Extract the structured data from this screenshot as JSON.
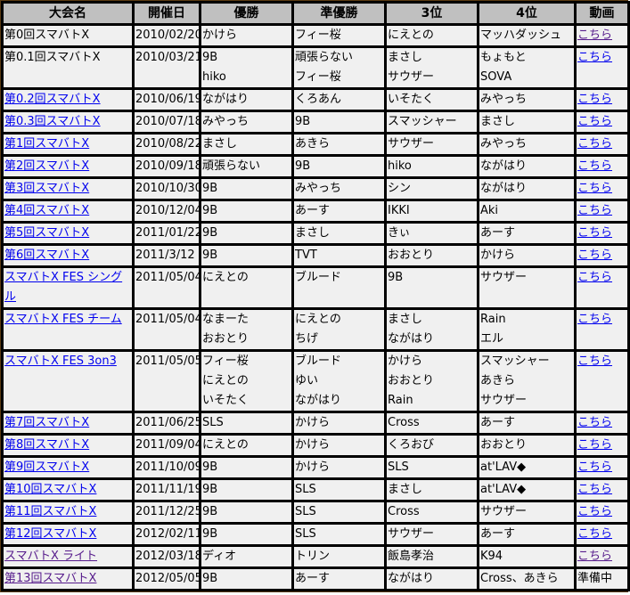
{
  "table": {
    "headers": [
      "大会名",
      "開催日",
      "優勝",
      "準優勝",
      "3位",
      "4位",
      "動画"
    ],
    "rows": [
      {
        "name": "第0回スマバトX",
        "name_link": false,
        "date": "2010/02/20",
        "winner": [
          "かけら"
        ],
        "runner_up": [
          "フィー桜"
        ],
        "third": [
          "にえとの"
        ],
        "fourth": [
          "マッハダッシュ"
        ],
        "video": "こちら",
        "video_visited": true
      },
      {
        "name": "第0.1回スマバトX",
        "name_link": false,
        "date": "2010/03/21",
        "winner": [
          "9B",
          "hiko"
        ],
        "runner_up": [
          "頑張らない",
          "フィー桜"
        ],
        "third": [
          "まさし",
          "サウザー"
        ],
        "fourth": [
          "もょもと",
          "SOVA"
        ],
        "video": "こちら",
        "video_visited": false
      },
      {
        "name": "第0.2回スマバトX",
        "name_link": true,
        "date": "2010/06/19",
        "winner": [
          "ながはり"
        ],
        "runner_up": [
          "くろあん"
        ],
        "third": [
          "いそたく"
        ],
        "fourth": [
          "みやっち"
        ],
        "video": "こちら",
        "video_visited": false
      },
      {
        "name": "第0.3回スマバトX",
        "name_link": true,
        "date": "2010/07/18",
        "winner": [
          "みやっち"
        ],
        "runner_up": [
          "9B"
        ],
        "third": [
          "スマッシャー"
        ],
        "fourth": [
          "まさし"
        ],
        "video": "こちら",
        "video_visited": false
      },
      {
        "name": "第1回スマバトX",
        "name_link": true,
        "date": "2010/08/22",
        "winner": [
          "まさし"
        ],
        "runner_up": [
          "あきら"
        ],
        "third": [
          "サウザー"
        ],
        "fourth": [
          "みやっち"
        ],
        "video": "こちら",
        "video_visited": false
      },
      {
        "name": "第2回スマバトX",
        "name_link": true,
        "date": "2010/09/18",
        "winner": [
          "頑張らない"
        ],
        "runner_up": [
          "9B"
        ],
        "third": [
          "hiko"
        ],
        "fourth": [
          "ながはり"
        ],
        "video": "こちら",
        "video_visited": false
      },
      {
        "name": "第3回スマバトX",
        "name_link": true,
        "date": "2010/10/30",
        "winner": [
          "9B"
        ],
        "runner_up": [
          "みやっち"
        ],
        "third": [
          "シン"
        ],
        "fourth": [
          "ながはり"
        ],
        "video": "こちら",
        "video_visited": false
      },
      {
        "name": "第4回スマバトX",
        "name_link": true,
        "date": "2010/12/04",
        "winner": [
          "9B"
        ],
        "runner_up": [
          "あーす"
        ],
        "third": [
          "IKKI"
        ],
        "fourth": [
          "Aki"
        ],
        "video": "こちら",
        "video_visited": false
      },
      {
        "name": "第5回スマバトX",
        "name_link": true,
        "date": "2011/01/22",
        "winner": [
          "9B"
        ],
        "runner_up": [
          "まさし"
        ],
        "third": [
          "きぃ"
        ],
        "fourth": [
          "あーす"
        ],
        "video": "こちら",
        "video_visited": false
      },
      {
        "name": "第6回スマバトX",
        "name_link": true,
        "date": "2011/3/12",
        "winner": [
          "9B"
        ],
        "runner_up": [
          "TVT"
        ],
        "third": [
          "おおとり"
        ],
        "fourth": [
          "かけら"
        ],
        "video": "こちら",
        "video_visited": false
      },
      {
        "name": "スマバトX FES シングル",
        "name_link": true,
        "date": "2011/05/04",
        "winner": [
          "にえとの"
        ],
        "runner_up": [
          "ブルード"
        ],
        "third": [
          "9B"
        ],
        "fourth": [
          "サウザー"
        ],
        "video": "こちら",
        "video_visited": false
      },
      {
        "name": "スマバトX FES チーム",
        "name_link": true,
        "date": "2011/05/04",
        "winner": [
          "なまーた",
          "おおとり"
        ],
        "runner_up": [
          "にえとの",
          "ちげ"
        ],
        "third": [
          "まさし",
          "ながはり"
        ],
        "fourth": [
          "Rain",
          "エル"
        ],
        "video": "こちら",
        "video_visited": false
      },
      {
        "name": "スマバトX FES 3on3",
        "name_link": true,
        "date": "2011/05/05",
        "winner": [
          "フィー桜",
          "にえとの",
          "いそたく"
        ],
        "runner_up": [
          "ブルード",
          "ゆい",
          "ながはり"
        ],
        "third": [
          "かけら",
          "おおとり",
          "Rain"
        ],
        "fourth": [
          "スマッシャー",
          "あきら",
          "サウザー"
        ],
        "video": "こちら",
        "video_visited": false
      },
      {
        "name": "第7回スマバトX",
        "name_link": true,
        "date": "2011/06/25",
        "winner": [
          "SLS"
        ],
        "runner_up": [
          "かけら"
        ],
        "third": [
          "Cross"
        ],
        "fourth": [
          "あーす"
        ],
        "video": "こちら",
        "video_visited": false
      },
      {
        "name": "第8回スマバトX",
        "name_link": true,
        "date": "2011/09/04",
        "winner": [
          "にえとの"
        ],
        "runner_up": [
          "かけら"
        ],
        "third": [
          "くろおび"
        ],
        "fourth": [
          "おおとり"
        ],
        "video": "こちら",
        "video_visited": false
      },
      {
        "name": "第9回スマバトX",
        "name_link": true,
        "date": "2011/10/09",
        "winner": [
          "9B"
        ],
        "runner_up": [
          "かけら"
        ],
        "third": [
          "SLS"
        ],
        "fourth": [
          "at'LAV◆"
        ],
        "video": "こちら",
        "video_visited": false
      },
      {
        "name": "第10回スマバトX",
        "name_link": true,
        "date": "2011/11/19",
        "winner": [
          "9B"
        ],
        "runner_up": [
          "SLS"
        ],
        "third": [
          "まさし"
        ],
        "fourth": [
          "at'LAV◆"
        ],
        "video": "こちら",
        "video_visited": false
      },
      {
        "name": "第11回スマバトX",
        "name_link": true,
        "date": "2011/12/25",
        "winner": [
          "9B"
        ],
        "runner_up": [
          "SLS"
        ],
        "third": [
          "Cross"
        ],
        "fourth": [
          "サウザー"
        ],
        "video": "こちら",
        "video_visited": false
      },
      {
        "name": "第12回スマバトX",
        "name_link": true,
        "date": "2012/02/11",
        "winner": [
          "9B"
        ],
        "runner_up": [
          "SLS"
        ],
        "third": [
          "サウザー"
        ],
        "fourth": [
          "あーす"
        ],
        "video": "こちら",
        "video_visited": false
      },
      {
        "name": "スマバトX ライト",
        "name_link": true,
        "name_visited": true,
        "date": "2012/03/18",
        "winner": [
          "ディオ"
        ],
        "runner_up": [
          "トリン"
        ],
        "third": [
          "飯島孝治"
        ],
        "fourth": [
          "K94"
        ],
        "video": "こちら",
        "video_visited": true
      },
      {
        "name": "第13回スマバトX",
        "name_link": true,
        "name_visited": true,
        "date": "2012/05/05",
        "winner": [
          "9B"
        ],
        "runner_up": [
          "あーす"
        ],
        "third": [
          "ながはり"
        ],
        "fourth": [
          "Cross、あきら"
        ],
        "video": "準備中",
        "video_is_link": false
      }
    ]
  },
  "colors": {
    "header_bg": "#c0c0c0",
    "cell_bg": "#f0f0f0",
    "border": "#000000",
    "outer_border": "#5a3a12",
    "link": "#0000ee",
    "visited_link": "#551a8b"
  }
}
